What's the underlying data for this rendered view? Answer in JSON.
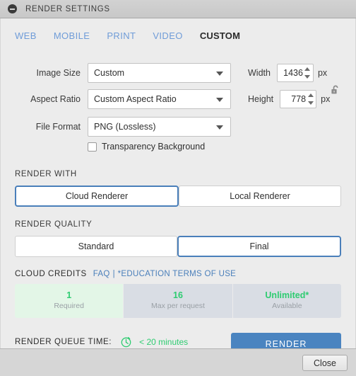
{
  "window": {
    "title": "RENDER SETTINGS",
    "collapse_icon": "minus-circle-icon"
  },
  "tabs": [
    {
      "label": "WEB",
      "active": false
    },
    {
      "label": "MOBILE",
      "active": false
    },
    {
      "label": "PRINT",
      "active": false
    },
    {
      "label": "VIDEO",
      "active": false
    },
    {
      "label": "CUSTOM",
      "active": true
    }
  ],
  "form": {
    "image_size": {
      "label": "Image Size",
      "value": "Custom"
    },
    "aspect_ratio": {
      "label": "Aspect Ratio",
      "value": "Custom Aspect Ratio"
    },
    "file_format": {
      "label": "File Format",
      "value": "PNG (Lossless)"
    },
    "width": {
      "label": "Width",
      "value": "1436",
      "unit": "px"
    },
    "height": {
      "label": "Height",
      "value": "778",
      "unit": "px"
    },
    "lock_icon": "unlocked-padlock-icon",
    "transparency": {
      "label": "Transparency Background",
      "checked": false
    }
  },
  "render_with": {
    "title": "RENDER WITH",
    "options": [
      {
        "label": "Cloud Renderer",
        "selected": true
      },
      {
        "label": "Local Renderer",
        "selected": false
      }
    ]
  },
  "render_quality": {
    "title": "RENDER QUALITY",
    "options": [
      {
        "label": "Standard",
        "selected": false
      },
      {
        "label": "Final",
        "selected": true
      }
    ]
  },
  "cloud_credits": {
    "title": "CLOUD CREDITS",
    "faq_link": "FAQ",
    "separator": "|",
    "terms_link": "*EDUCATION TERMS OF USE",
    "items": [
      {
        "value": "1",
        "label": "Required",
        "highlight": true
      },
      {
        "value": "16",
        "label": "Max per request",
        "highlight": false
      },
      {
        "value": "Unlimited*",
        "label": "Available",
        "highlight": false
      }
    ]
  },
  "queue": {
    "label": "RENDER QUEUE TIME:",
    "icon": "stopwatch-icon",
    "time": "< 20 minutes"
  },
  "actions": {
    "render": "RENDER",
    "close": "Close"
  },
  "colors": {
    "accent_blue": "#4a84c0",
    "link_blue": "#4a7fba",
    "tab_blue": "#6f9cd8",
    "green": "#2ecc71",
    "credit_green_bg": "#e3f6e7",
    "credit_bg": "#d9dde4",
    "panel_bg": "#ececec",
    "chrome_bg": "#d6d6d6"
  }
}
